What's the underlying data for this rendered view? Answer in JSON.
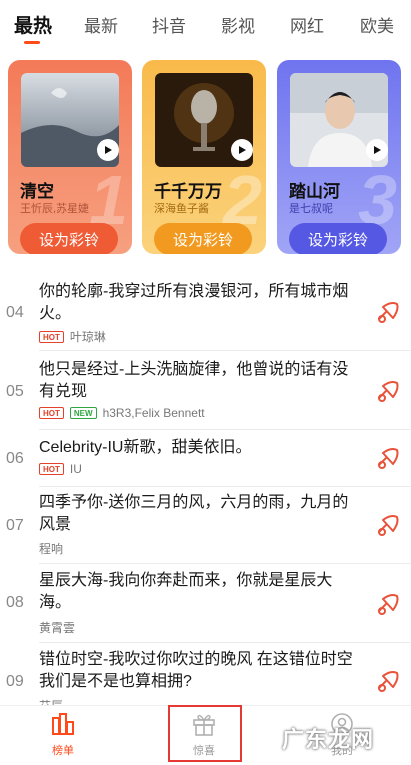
{
  "tabs": [
    {
      "label": "最热",
      "active": true
    },
    {
      "label": "最新"
    },
    {
      "label": "抖音"
    },
    {
      "label": "影视"
    },
    {
      "label": "网红"
    },
    {
      "label": "欧美"
    }
  ],
  "cards": [
    {
      "title": "清空",
      "artist": "王忻辰,苏星婕",
      "rank": "1",
      "button": "设为彩铃",
      "color": "#f47a58"
    },
    {
      "title": "千千万万",
      "artist": "深海鱼子酱",
      "rank": "2",
      "button": "设为彩铃",
      "color": "#f9ba4a"
    },
    {
      "title": "踏山河",
      "artist": "是七叔呢",
      "rank": "3",
      "button": "设为彩铃",
      "color": "#6f74ef"
    }
  ],
  "songs": [
    {
      "num": "04",
      "title": "你的轮廓-我穿过所有浪漫银河，所有城市烟火。",
      "badges": [
        "HOT"
      ],
      "artist": "叶琼琳"
    },
    {
      "num": "05",
      "title": "他只是经过-上头洗脑旋律，他曾说的话有没有兑现",
      "badges": [
        "HOT",
        "NEW"
      ],
      "artist": "h3R3,Felix Bennett"
    },
    {
      "num": "06",
      "title": "Celebrity-IU新歌，甜美依旧。",
      "badges": [
        "HOT"
      ],
      "artist": "IU"
    },
    {
      "num": "07",
      "title": "四季予你-送你三月的风，六月的雨，九月的风景",
      "badges": [],
      "artist": "程响"
    },
    {
      "num": "08",
      "title": "星辰大海-我向你奔赴而来，你就是星辰大海。",
      "badges": [],
      "artist": "黄霄雲"
    },
    {
      "num": "09",
      "title": "错位时空-我吹过你吹过的晚风 在这错位时空我们是不是也算相拥?",
      "badges": [],
      "artist": "艾辰"
    }
  ],
  "bottom_nav": [
    {
      "label": "榜单",
      "icon": "chart-list-icon",
      "active": true
    },
    {
      "label": "惊喜",
      "icon": "gift-icon",
      "active": false
    },
    {
      "label": "我的",
      "icon": "profile-icon",
      "active": false
    }
  ],
  "watermark": "广东龙网",
  "colors": {
    "accent": "#ff4a1c",
    "hot": "#e4402a",
    "new": "#2fa642"
  }
}
